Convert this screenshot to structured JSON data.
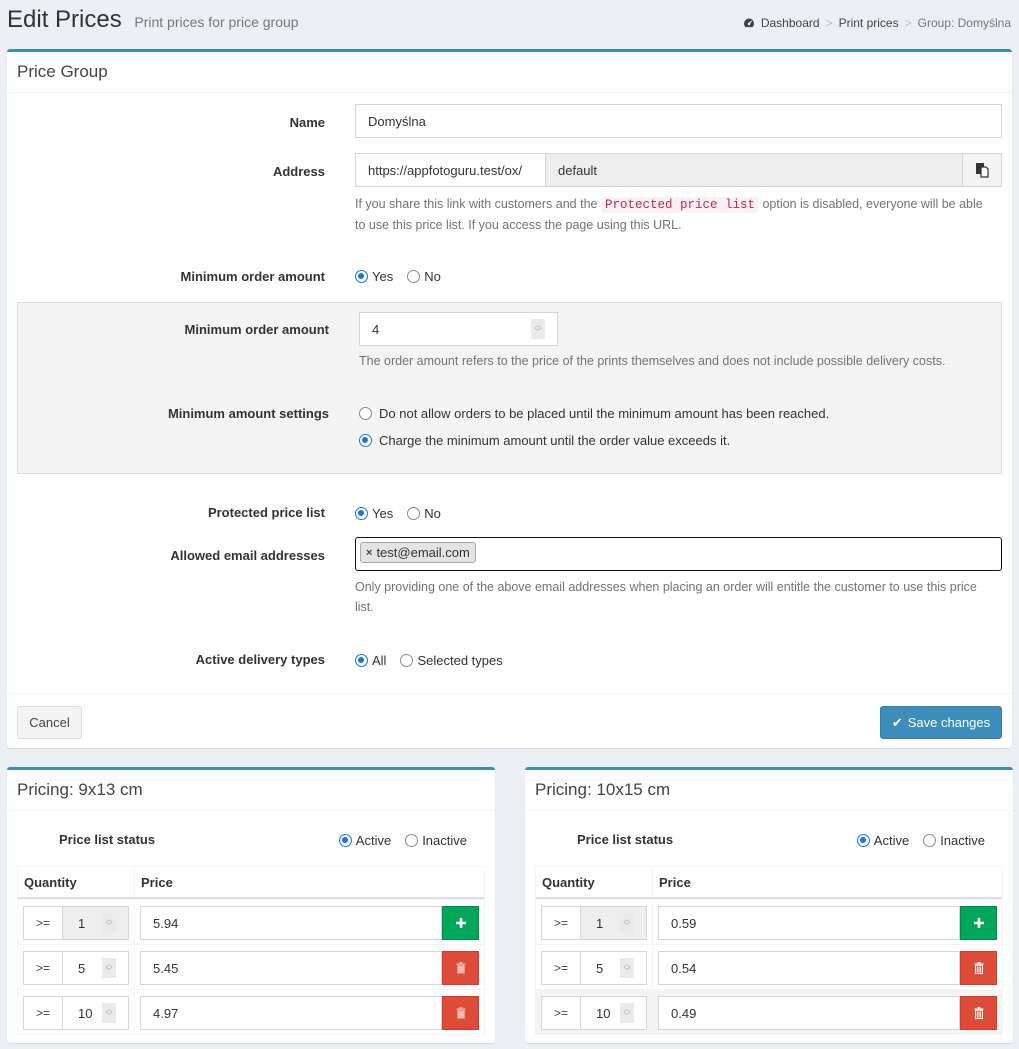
{
  "header": {
    "title": "Edit Prices",
    "subtitle": "Print prices for price group",
    "breadcrumb": [
      {
        "label": "Dashboard",
        "icon": "dashboard-icon"
      },
      {
        "label": "Print prices"
      },
      {
        "label": "Group: Domyślna"
      }
    ],
    "breadcrumb_separator": ">"
  },
  "price_group": {
    "title": "Price Group",
    "name": {
      "label": "Name",
      "value": "Domyślna"
    },
    "address": {
      "label": "Address",
      "prefix": "https://appfotoguru.test/ox/",
      "value": "default",
      "copy_icon": "copy-icon",
      "help_before": "If you share this link with customers and the ",
      "help_code": "Protected price list",
      "help_after": " option is disabled, everyone will be able to use this price list. If you access the page using this URL."
    },
    "min_order_toggle": {
      "label": "Minimum order amount",
      "options": [
        "Yes",
        "No"
      ],
      "selected": "Yes"
    },
    "min_order_amount": {
      "label": "Minimum order amount",
      "value": "4",
      "help": "The order amount refers to the price of the prints themselves and does not include possible delivery costs."
    },
    "min_amount_settings": {
      "label": "Minimum amount settings",
      "options": [
        "Do not allow orders to be placed until the minimum amount has been reached.",
        "Charge the minimum amount until the order value exceeds it."
      ],
      "selected_index": 1
    },
    "protected": {
      "label": "Protected price list",
      "options": [
        "Yes",
        "No"
      ],
      "selected": "Yes"
    },
    "emails": {
      "label": "Allowed email addresses",
      "tags": [
        "test@email.com"
      ],
      "remove_glyph": "×",
      "help": "Only providing one of the above email addresses when placing an order will entitle the customer to use this price list."
    },
    "delivery": {
      "label": "Active delivery types",
      "options": [
        "All",
        "Selected types"
      ],
      "selected": "All"
    },
    "cancel_label": "Cancel",
    "save_label": "Save changes"
  },
  "pricing": [
    {
      "title": "Pricing: 9x13 cm",
      "status_label": "Price list status",
      "status_options": [
        "Active",
        "Inactive"
      ],
      "status_selected": "Active",
      "col_quantity": "Quantity",
      "col_price": "Price",
      "rows": [
        {
          "op": ">=",
          "qty": "1",
          "price": "5.94",
          "action": "add"
        },
        {
          "op": ">=",
          "qty": "5",
          "price": "5.45",
          "action": "delete"
        },
        {
          "op": ">=",
          "qty": "10",
          "price": "4.97",
          "action": "delete"
        }
      ]
    },
    {
      "title": "Pricing: 10x15 cm",
      "status_label": "Price list status",
      "status_options": [
        "Active",
        "Inactive"
      ],
      "status_selected": "Active",
      "col_quantity": "Quantity",
      "col_price": "Price",
      "rows": [
        {
          "op": ">=",
          "qty": "1",
          "price": "0.59",
          "action": "add"
        },
        {
          "op": ">=",
          "qty": "5",
          "price": "0.54",
          "action": "delete"
        },
        {
          "op": ">=",
          "qty": "10",
          "price": "0.49",
          "action": "delete"
        }
      ]
    }
  ],
  "colors": {
    "primary": "#3c8dbc",
    "success": "#00a65a",
    "danger": "#dd4b39",
    "radio_checked": "#1a73e8"
  }
}
